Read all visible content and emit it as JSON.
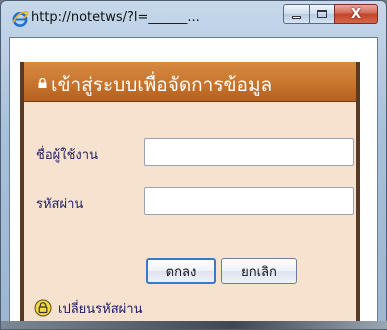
{
  "window": {
    "title": "http://notetws/?l=______...",
    "controls": {
      "minimize": "minimize",
      "maximize": "maximize",
      "close": "X"
    }
  },
  "panel": {
    "header": "เข้าสู่ระบบเพื่อจัดการข้อมูล",
    "fields": {
      "username_label": "ชื่อผู้ใช้งาน",
      "username_value": "",
      "password_label": "รหัสผ่าน",
      "password_value": ""
    },
    "buttons": {
      "ok": "ตกลง",
      "cancel": "ยกเลิก"
    },
    "change_password_link": "เปลี่ยนรหัสผ่าน"
  },
  "icons": {
    "browser": "internet-explorer-icon",
    "header_lock": "lock-icon",
    "change_password": "lock-circle-icon"
  },
  "colors": {
    "header_bar": "#c9772f",
    "panel_bg": "#f7e2cf",
    "panel_border": "#5a3a24",
    "label_text": "#222266",
    "close_button": "#c2432a"
  }
}
